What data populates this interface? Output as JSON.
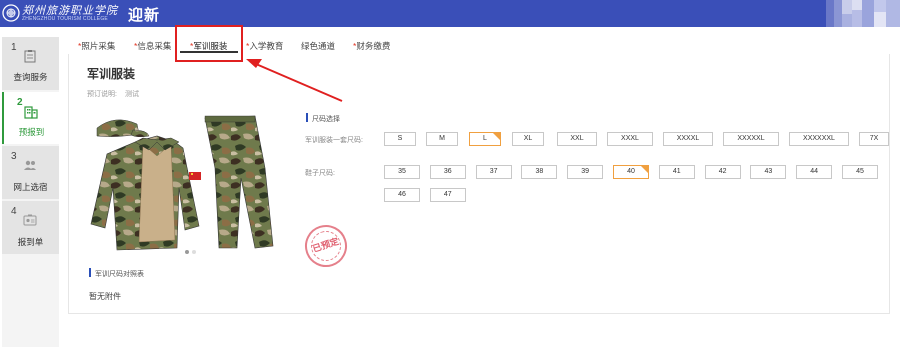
{
  "header": {
    "logo_text": "郑州旅游职业学院",
    "logo_subtitle": "ZHENGZHOU TOURISM COLLEGE",
    "title": "迎新"
  },
  "sidebar": {
    "items": [
      {
        "num": "1",
        "label": "查询服务",
        "icon": "clipboard-icon"
      },
      {
        "num": "2",
        "label": "预报到",
        "icon": "building-icon"
      },
      {
        "num": "3",
        "label": "网上选宿",
        "icon": "people-icon"
      },
      {
        "num": "4",
        "label": "报到单",
        "icon": "id-card-icon"
      }
    ]
  },
  "tabs": [
    {
      "label": "照片采集",
      "required": true
    },
    {
      "label": "信息采集",
      "required": true
    },
    {
      "label": "军训服装",
      "required": true
    },
    {
      "label": "入学教育",
      "required": true
    },
    {
      "label": "绿色通道",
      "required": false
    },
    {
      "label": "财务缴费",
      "required": true
    }
  ],
  "page": {
    "title": "军训服装",
    "remark_label": "预订说明:",
    "remark_value": "测试",
    "size_section_title": "尺码选择",
    "uniform_label": "军训服装一套尺码:",
    "uniform_sizes": [
      "S",
      "M",
      "L",
      "XL",
      "XXL",
      "XXXL",
      "XXXXL",
      "XXXXXL",
      "XXXXXXL",
      "7X"
    ],
    "uniform_selected": "L",
    "shoe_label": "鞋子尺码:",
    "shoe_sizes": [
      "35",
      "36",
      "37",
      "38",
      "39",
      "40",
      "41",
      "42",
      "43",
      "44",
      "45",
      "46",
      "47"
    ],
    "shoe_selected": "40",
    "stamp_text": "已预定",
    "chart_section_title": "军训尺码对照表",
    "no_attachment": "暂无附件"
  },
  "colors": {
    "header_bg": "#3a4fb8",
    "active_green": "#2f9a3c",
    "required_star": "#e0301e",
    "selected_border": "#f0a040",
    "annotation_red": "#e02020"
  }
}
